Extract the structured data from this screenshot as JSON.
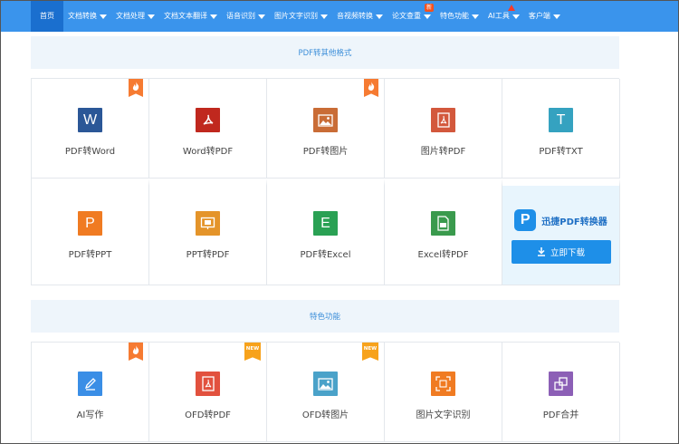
{
  "nav": [
    {
      "label": "首页",
      "active": true,
      "caret": false
    },
    {
      "label": "文档转换",
      "caret": true
    },
    {
      "label": "文档处理",
      "caret": true
    },
    {
      "label": "文档文本翻译",
      "caret": true
    },
    {
      "label": "语音识别",
      "caret": true
    },
    {
      "label": "图片文字识别",
      "caret": true
    },
    {
      "label": "音视频转换",
      "caret": true
    },
    {
      "label": "论文查重",
      "caret": true,
      "badge": "新"
    },
    {
      "label": "特色功能",
      "caret": true
    },
    {
      "label": "AI工具",
      "caret": true,
      "triangle": true
    },
    {
      "label": "客户端",
      "caret": true
    }
  ],
  "sections": {
    "other_formats": "PDF转其他格式",
    "featured": "特色功能"
  },
  "row1": [
    {
      "label": "PDF转Word",
      "icon": "word-icon",
      "glyph": "W",
      "color": "#2b5797",
      "tag": "hot"
    },
    {
      "label": "Word转PDF",
      "icon": "pdf-icon",
      "glyph": "pdf",
      "color": "#c0281e",
      "tag": ""
    },
    {
      "label": "PDF转图片",
      "icon": "image-icon",
      "glyph": "img",
      "color": "#c96c36",
      "tag": "hot"
    },
    {
      "label": "图片转PDF",
      "icon": "pdf-icon",
      "glyph": "pdf",
      "color": "#d3583c",
      "tag": ""
    },
    {
      "label": "PDF转TXT",
      "icon": "text-icon",
      "glyph": "T",
      "color": "#35a2c0",
      "tag": ""
    }
  ],
  "row2": [
    {
      "label": "PDF转PPT",
      "icon": "ppt-icon",
      "glyph": "P",
      "color": "#f07b22",
      "tag": ""
    },
    {
      "label": "PPT转PDF",
      "icon": "ppt-pdf-icon",
      "glyph": "ppt",
      "color": "#e4942a",
      "tag": ""
    },
    {
      "label": "PDF转Excel",
      "icon": "excel-icon",
      "glyph": "E",
      "color": "#2aa154",
      "tag": ""
    },
    {
      "label": "Excel转PDF",
      "icon": "excel-pdf-icon",
      "glyph": "xls",
      "color": "#3a9a4d",
      "tag": ""
    }
  ],
  "promo": {
    "logo": "P",
    "name": "迅捷PDF转换器",
    "button": "立即下载"
  },
  "row3": [
    {
      "label": "AI写作",
      "icon": "ai-writing-icon",
      "glyph": "pen",
      "color": "#3a8ee6",
      "tag": "hot"
    },
    {
      "label": "OFD转PDF",
      "icon": "pdf-icon",
      "glyph": "pdf",
      "color": "#e2513e",
      "tag": "new"
    },
    {
      "label": "OFD转图片",
      "icon": "image-icon",
      "glyph": "img",
      "color": "#4aa2c9",
      "tag": "new"
    },
    {
      "label": "图片文字识别",
      "icon": "ocr-icon",
      "glyph": "ocr",
      "color": "#f07b22",
      "tag": ""
    },
    {
      "label": "PDF合并",
      "icon": "merge-icon",
      "glyph": "merge",
      "color": "#8c5fb6",
      "tag": ""
    }
  ],
  "new_tag_text": "NEW"
}
